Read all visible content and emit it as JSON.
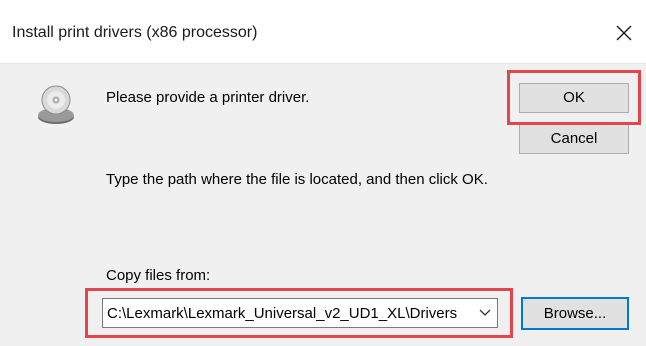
{
  "window": {
    "title": "Install print drivers (x86 processor)"
  },
  "icons": {
    "disc": "disc-icon",
    "close": "close-icon",
    "dropdown": "chevron-down-icon"
  },
  "main": {
    "message": "Please provide a printer driver.",
    "instruction": "Type the path where the file is located, and then click OK.",
    "copy_label": "Copy files from:",
    "path_value": "C:\\Lexmark\\Lexmark_Universal_v2_UD1_XL\\Drivers"
  },
  "buttons": {
    "ok": "OK",
    "cancel": "Cancel",
    "browse": "Browse..."
  },
  "colors": {
    "highlight": "#e0474c",
    "focus": "#0078d7"
  }
}
